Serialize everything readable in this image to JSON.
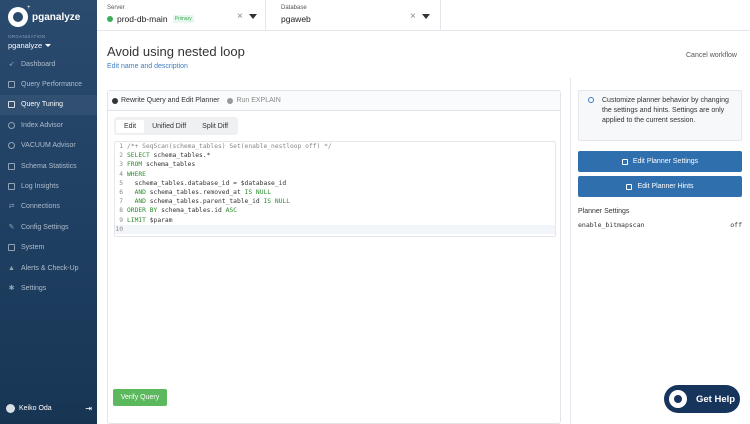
{
  "app": {
    "name": "pganalyze",
    "superscript": "+"
  },
  "org": {
    "label": "ORGANIZATION",
    "name": "pganalyze"
  },
  "nav": [
    {
      "label": "Dashboard",
      "icon": "rocket-icon"
    },
    {
      "label": "Query Performance",
      "icon": "chart-icon"
    },
    {
      "label": "Query Tuning",
      "icon": "book-icon",
      "active": true
    },
    {
      "label": "Index Advisor",
      "icon": "index-icon"
    },
    {
      "label": "VACUUM Advisor",
      "icon": "vacuum-icon"
    },
    {
      "label": "Schema Statistics",
      "icon": "grid-icon"
    },
    {
      "label": "Log Insights",
      "icon": "log-icon"
    },
    {
      "label": "Connections",
      "icon": "connection-icon"
    },
    {
      "label": "Config Settings",
      "icon": "wrench-icon"
    },
    {
      "label": "System",
      "icon": "monitor-icon"
    },
    {
      "label": "Alerts & Check-Up",
      "icon": "bell-icon"
    },
    {
      "label": "Settings",
      "icon": "gear-icon"
    }
  ],
  "user": {
    "name": "Keiko Oda"
  },
  "server": {
    "label": "Server",
    "value": "prod-db-main",
    "badge": "Primary"
  },
  "database": {
    "label": "Database",
    "value": "pgaweb"
  },
  "page": {
    "title": "Avoid using nested loop",
    "edit_link": "Edit name and description",
    "cancel": "Cancel workflow"
  },
  "panel": {
    "rewrite_label": "Rewrite Query and Edit Planner",
    "run_label": "Run EXPLAIN",
    "tabs": [
      "Edit",
      "Unified Diff",
      "Split Diff"
    ],
    "active_tab": "Edit",
    "verify_button": "Verify Query"
  },
  "editor": {
    "lines": [
      {
        "n": "1",
        "text": "/*+ SeqScan(schema_tables) Set(enable_nestloop off) */"
      },
      {
        "n": "2",
        "text": "SELECT schema_tables.*"
      },
      {
        "n": "3",
        "text": "FROM schema_tables"
      },
      {
        "n": "4",
        "text": "WHERE"
      },
      {
        "n": "5",
        "text": "  schema_tables.database_id = $database_id"
      },
      {
        "n": "6",
        "text": "  AND schema_tables.removed_at IS NULL"
      },
      {
        "n": "7",
        "text": "  AND schema_tables.parent_table_id IS NULL"
      },
      {
        "n": "8",
        "text": "ORDER BY schema_tables.id ASC"
      },
      {
        "n": "9",
        "text": "LIMIT $param"
      },
      {
        "n": "10",
        "text": ""
      }
    ]
  },
  "right": {
    "info": "Customize planner behavior by changing the settings and hints. Settings are only applied to the current session.",
    "edit_settings": "Edit Planner Settings",
    "edit_hints": "Edit Planner Hints",
    "settings_title": "Planner Settings",
    "settings": [
      {
        "name": "enable_bitmapscan",
        "value": "off"
      }
    ]
  },
  "help": {
    "label": "Get Help"
  },
  "colors": {
    "accent": "#2f6fad",
    "success": "#5cb85c",
    "sidebar": "#1f3f62",
    "link": "#3d7dbf"
  }
}
